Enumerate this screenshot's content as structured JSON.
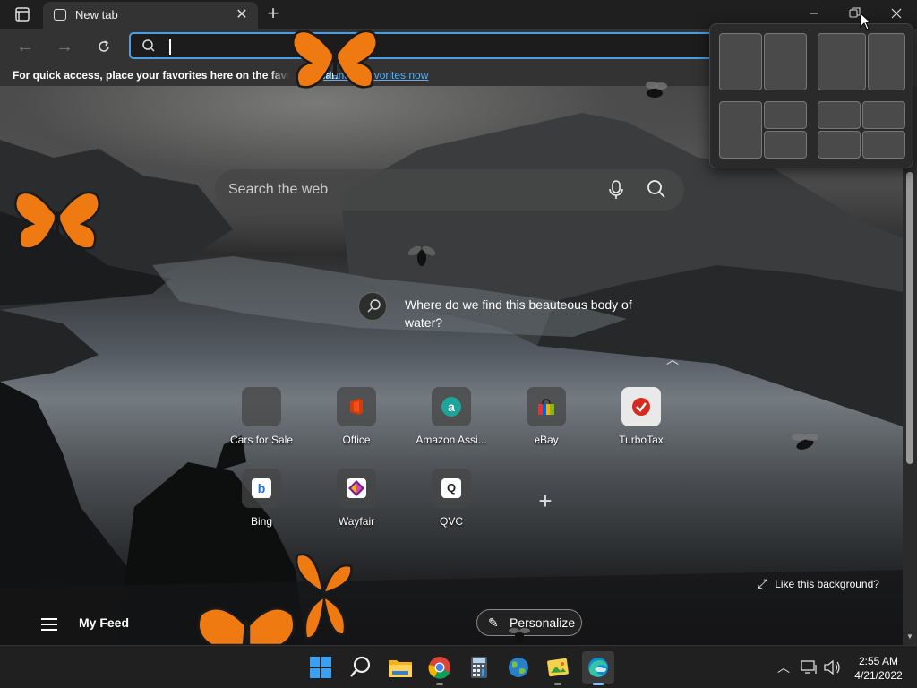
{
  "browser": {
    "tab_title": "New tab",
    "address_value": "",
    "favorites_bar": {
      "message": "For quick access, place your favorites here on the favorites bar.",
      "link": "Manage favorites now"
    }
  },
  "newtab": {
    "search_placeholder": "Search the web",
    "background_question": "Where do we find this beauteous body of water?",
    "tiles": [
      {
        "label": "Cars for Sale",
        "icon": "blank-tile-icon"
      },
      {
        "label": "Office",
        "icon": "office-icon",
        "color": "#d83b01"
      },
      {
        "label": "Amazon Assi...",
        "icon": "amazon-assistant-icon",
        "color": "#1ca59a",
        "glyph": "a"
      },
      {
        "label": "eBay",
        "icon": "ebay-bag-icon"
      },
      {
        "label": "TurboTax",
        "icon": "turbotax-check-icon",
        "color": "#d52b1e"
      },
      {
        "label": "Bing",
        "icon": "bing-icon",
        "color": "#1a73e8",
        "glyph": "b"
      },
      {
        "label": "Wayfair",
        "icon": "wayfair-icon",
        "color": "#7b189f"
      },
      {
        "label": "QVC",
        "icon": "qvc-icon",
        "color": "#ffffff",
        "glyph": "Q"
      }
    ],
    "like_background": "Like this background?",
    "feed_title": "My Feed",
    "personalize": "Personalize"
  },
  "taskbar": {
    "apps": [
      "windows-start-icon",
      "search-icon",
      "file-explorer-icon",
      "chrome-icon",
      "calculator-icon",
      "maps-icon",
      "photos-icon",
      "edge-icon"
    ],
    "time": "2:55 AM",
    "date": "4/21/2022"
  },
  "colors": {
    "accent": "#4a9fe6",
    "link": "#59aef6",
    "butterfly": "#f07a12"
  }
}
